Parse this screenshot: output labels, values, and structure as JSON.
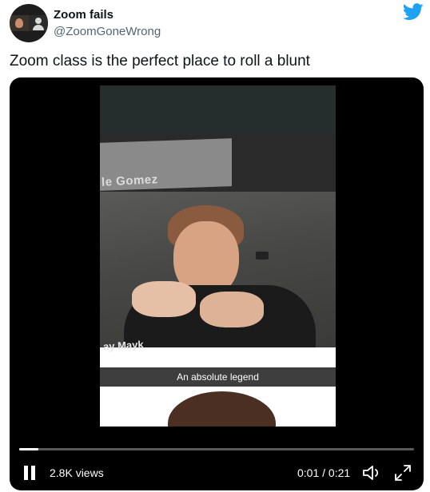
{
  "user": {
    "display_name": "Zoom fails",
    "handle": "@ZoomGoneWrong",
    "avatar_icon": "zoom-call-avatar-icon"
  },
  "logo_icon": "twitter-bird-icon",
  "logo_color": "#1da1f2",
  "tweet": {
    "text": "Zoom class is the perfect place to roll a blunt"
  },
  "video": {
    "caption": "An absolute legend",
    "name_overlay_top": "le Gomez",
    "name_overlay_bottom": "ay Mayk",
    "views": "2.8K views",
    "time_display": "0:01 / 0:21",
    "progress": 0.048,
    "controls": {
      "pause_icon": "pause-icon",
      "volume_icon": "volume-icon",
      "fullscreen_icon": "fullscreen-icon"
    }
  }
}
